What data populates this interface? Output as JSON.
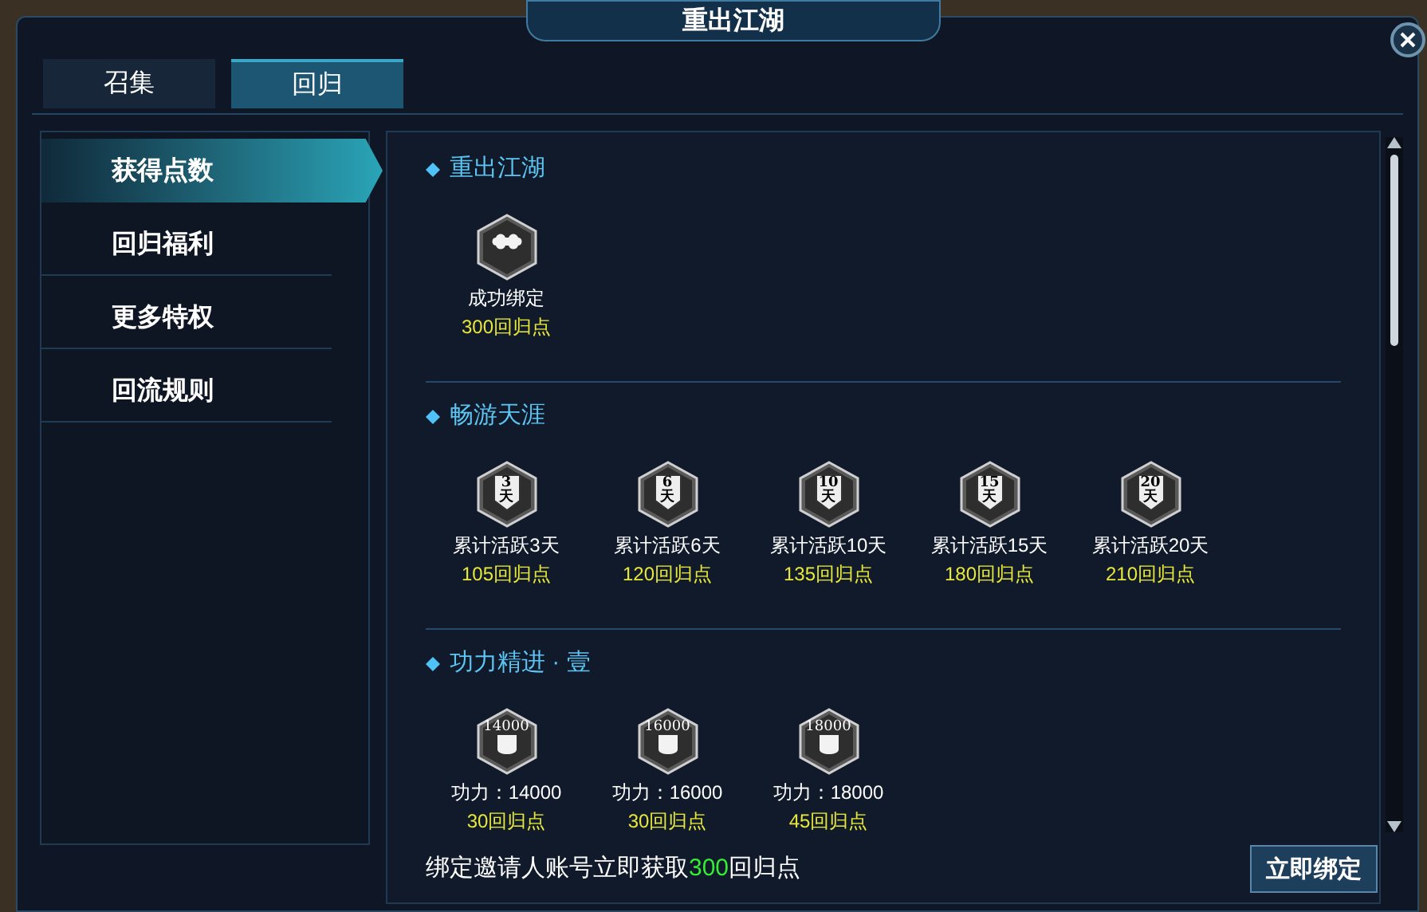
{
  "window": {
    "title": "重出江湖"
  },
  "tabs": [
    {
      "label": "召集",
      "selected": false
    },
    {
      "label": "回归",
      "selected": true
    }
  ],
  "sidebar": {
    "items": [
      {
        "label": "获得点数",
        "selected": true
      },
      {
        "label": "回归福利",
        "selected": false
      },
      {
        "label": "更多特权",
        "selected": false
      },
      {
        "label": "回流规则",
        "selected": false
      }
    ]
  },
  "sections": [
    {
      "title": "重出江湖",
      "items": [
        {
          "kind": "bind",
          "label": "成功绑定",
          "points": "300回归点"
        }
      ]
    },
    {
      "title": "畅游天涯",
      "items": [
        {
          "kind": "days",
          "badge_number": "3",
          "badge_unit": "天",
          "label": "累计活跃3天",
          "points": "105回归点"
        },
        {
          "kind": "days",
          "badge_number": "6",
          "badge_unit": "天",
          "label": "累计活跃6天",
          "points": "120回归点"
        },
        {
          "kind": "days",
          "badge_number": "10",
          "badge_unit": "天",
          "label": "累计活跃10天",
          "points": "135回归点"
        },
        {
          "kind": "days",
          "badge_number": "15",
          "badge_unit": "天",
          "label": "累计活跃15天",
          "points": "180回归点"
        },
        {
          "kind": "days",
          "badge_number": "20",
          "badge_unit": "天",
          "label": "累计活跃20天",
          "points": "210回归点"
        }
      ]
    },
    {
      "title": "功力精进 · 壹",
      "items": [
        {
          "kind": "power",
          "badge_number": "14000",
          "label": "功力：14000",
          "points": "30回归点"
        },
        {
          "kind": "power",
          "badge_number": "16000",
          "label": "功力：16000",
          "points": "30回归点"
        },
        {
          "kind": "power",
          "badge_number": "18000",
          "label": "功力：18000",
          "points": "45回归点"
        }
      ]
    }
  ],
  "footer": {
    "message": "绑定邀请人账号立即获取**300**回归点",
    "button": "立即绑定"
  }
}
